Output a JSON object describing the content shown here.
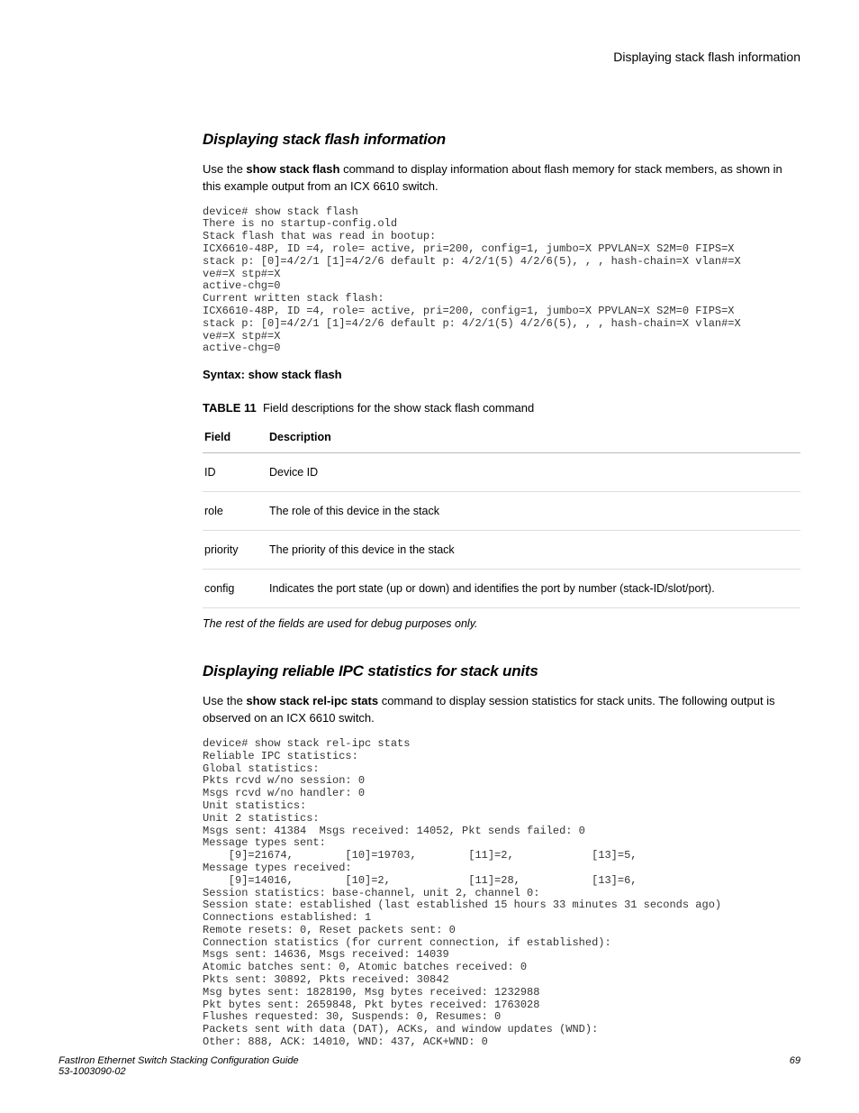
{
  "header": {
    "running_title": "Displaying stack flash information"
  },
  "section1": {
    "heading": "Displaying stack flash information",
    "para_pre": "Use the ",
    "para_cmd": "show stack flash",
    "para_post": " command to display information about flash memory for stack members, as shown in this example output from an ICX 6610 switch.",
    "code": "device# show stack flash\nThere is no startup-config.old\nStack flash that was read in bootup:\nICX6610-48P, ID =4, role= active, pri=200, config=1, jumbo=X PPVLAN=X S2M=0 FIPS=X\nstack p: [0]=4/2/1 [1]=4/2/6 default p: 4/2/1(5) 4/2/6(5), , , hash-chain=X vlan#=X\nve#=X stp#=X\nactive-chg=0\nCurrent written stack flash:\nICX6610-48P, ID =4, role= active, pri=200, config=1, jumbo=X PPVLAN=X S2M=0 FIPS=X\nstack p: [0]=4/2/1 [1]=4/2/6 default p: 4/2/1(5) 4/2/6(5), , , hash-chain=X vlan#=X\nve#=X stp#=X\nactive-chg=0",
    "syntax": "Syntax: show stack flash",
    "table_caption_label": "TABLE 11",
    "table_caption_text": "Field descriptions for the show stack flash command",
    "table_field_hdr": "Field",
    "table_desc_hdr": "Description",
    "rows": [
      {
        "field": "ID",
        "desc": "Device ID"
      },
      {
        "field": "role",
        "desc": "The role of this device in the stack"
      },
      {
        "field": "priority",
        "desc": "The priority of this device in the stack"
      },
      {
        "field": "config",
        "desc": "Indicates the port state (up or down) and identifies the port by number (stack-ID/slot/port)."
      }
    ],
    "table_note": "The rest of the fields are used for debug purposes only."
  },
  "section2": {
    "heading": "Displaying reliable IPC statistics for stack units",
    "para_pre": "Use the ",
    "para_cmd": "show stack rel-ipc stats",
    "para_post": " command to display session statistics for stack units. The following output is observed on an ICX 6610 switch.",
    "code": "device# show stack rel-ipc stats\nReliable IPC statistics:\nGlobal statistics:\nPkts rcvd w/no session: 0\nMsgs rcvd w/no handler: 0\nUnit statistics:\nUnit 2 statistics:\nMsgs sent: 41384  Msgs received: 14052, Pkt sends failed: 0\nMessage types sent:\n    [9]=21674,        [10]=19703,        [11]=2,            [13]=5,\nMessage types received:\n    [9]=14016,        [10]=2,            [11]=28,           [13]=6,\nSession statistics: base-channel, unit 2, channel 0:\nSession state: established (last established 15 hours 33 minutes 31 seconds ago)\nConnections established: 1\nRemote resets: 0, Reset packets sent: 0\nConnection statistics (for current connection, if established):\nMsgs sent: 14636, Msgs received: 14039\nAtomic batches sent: 0, Atomic batches received: 0\nPkts sent: 30892, Pkts received: 30842\nMsg bytes sent: 1828190, Msg bytes received: 1232988\nPkt bytes sent: 2659848, Pkt bytes received: 1763028\nFlushes requested: 30, Suspends: 0, Resumes: 0\nPackets sent with data (DAT), ACKs, and window updates (WND):\nOther: 888, ACK: 14010, WND: 437, ACK+WND: 0"
  },
  "footer": {
    "doc_title": "FastIron Ethernet Switch Stacking Configuration Guide",
    "doc_number": "53-1003090-02",
    "page_number": "69"
  }
}
